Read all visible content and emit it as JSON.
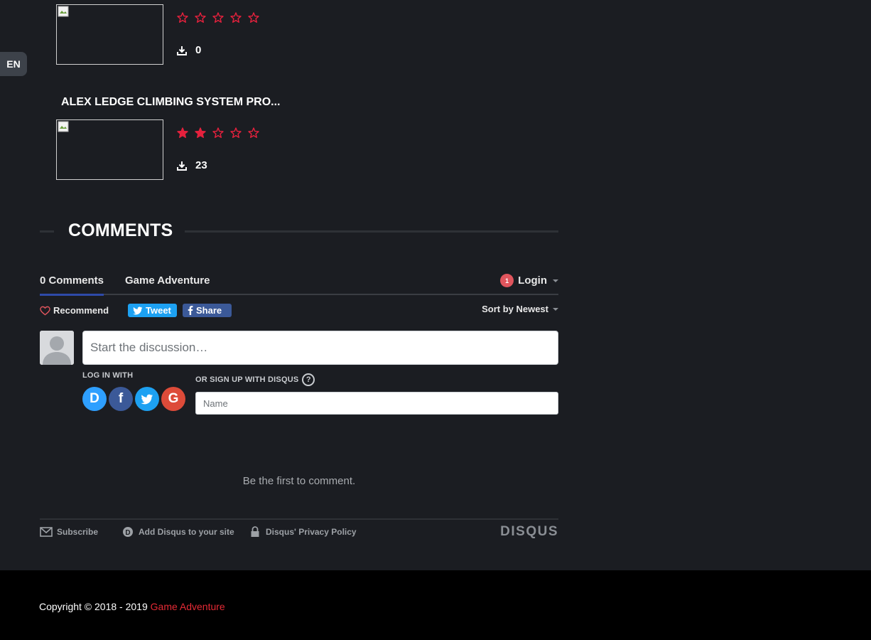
{
  "language": {
    "code": "EN"
  },
  "games": [
    {
      "title": "",
      "rating": 0,
      "max_rating": 5,
      "downloads": "0"
    },
    {
      "title": "ALEX LEDGE CLIMBING SYSTEM PRO...",
      "rating": 2,
      "max_rating": 5,
      "downloads": "23"
    }
  ],
  "comments": {
    "heading": "COMMENTS",
    "tabs": {
      "count_label": "0 Comments",
      "site_label": "Game Adventure"
    },
    "login": {
      "badge": "1",
      "label": "Login"
    },
    "actions": {
      "recommend": "Recommend",
      "tweet": "Tweet",
      "share": "Share",
      "sort": "Sort by Newest"
    },
    "compose": {
      "placeholder": "Start the discussion…",
      "login_with": "LOG IN WITH",
      "signup_label": "OR SIGN UP WITH DISQUS",
      "name_placeholder": "Name",
      "social": [
        "D",
        "f",
        "G"
      ]
    },
    "empty_message": "Be the first to comment.",
    "footer": {
      "subscribe": "Subscribe",
      "add_disqus": "Add Disqus to your site",
      "privacy": "Disqus' Privacy Policy",
      "logo": "DISQUS"
    }
  },
  "footer": {
    "copyright_prefix": "Copyright © 2018 - 2019",
    "brand": "Game Adventure"
  },
  "colors": {
    "star": "#e5213d",
    "accent_red": "#e52a35",
    "background": "#1b1d22"
  }
}
